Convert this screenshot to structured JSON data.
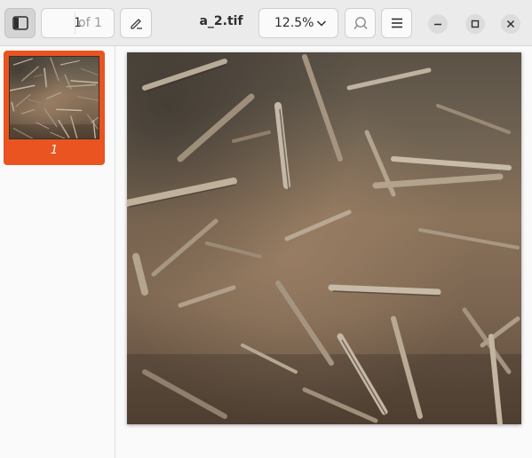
{
  "header": {
    "title": "a_2.tif",
    "page_current": "1",
    "page_total": "of 1",
    "zoom": "12.5%"
  },
  "sidebar": {
    "thumbnails": [
      {
        "label": "1"
      }
    ]
  },
  "colors": {
    "accent": "#e95420",
    "headerbar": "#ebebeb"
  },
  "icons": [
    "sidebar-toggle-icon",
    "annotate-pen-icon",
    "chevron-down-icon",
    "search-icon",
    "menu-icon",
    "minimize-icon",
    "maximize-icon",
    "close-icon"
  ]
}
